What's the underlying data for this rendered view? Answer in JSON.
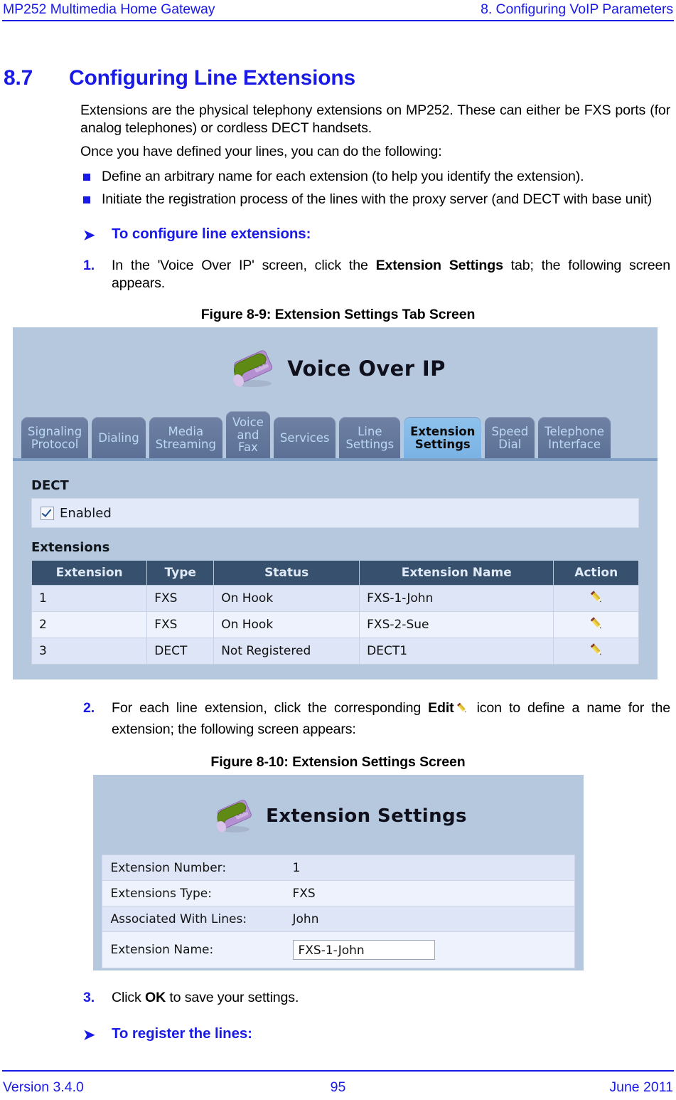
{
  "header": {
    "left": "MP252 Multimedia Home Gateway",
    "right": "8. Configuring VoIP Parameters"
  },
  "section": {
    "number": "8.7",
    "title": "Configuring Line Extensions",
    "intro_p1": "Extensions are the physical telephony extensions on MP252. These can either be FXS ports (for analog telephones) or cordless DECT handsets.",
    "intro_p2": "Once you have defined your lines, you can do the following:",
    "bullets": [
      "Define an arbitrary name for each extension (to help you identify the extension).",
      "Initiate the registration process of the lines with the proxy server (and DECT with base unit)"
    ],
    "procedure_heading_1": "To configure line extensions:",
    "step1_num": "1.",
    "step1_pre": "In the 'Voice Over IP' screen, click the ",
    "step1_bold": "Extension Settings",
    "step1_post": " tab; the following screen appears.",
    "step2_num": "2.",
    "step2_pre": "For each line extension, click the corresponding ",
    "step2_bold": "Edit",
    "step2_post": " icon to define a name for the extension; the following screen appears:",
    "step3_num": "3.",
    "step3_pre": "Click ",
    "step3_bold": "OK",
    "step3_post": " to save your settings.",
    "procedure_heading_2": "To register the lines:",
    "arrow_glyph": "➤"
  },
  "figure1": {
    "caption": "Figure 8-9: Extension Settings Tab Screen",
    "app_title": "Voice Over IP",
    "tabs": [
      {
        "label": "Signaling\nProtocol",
        "active": false
      },
      {
        "label": "Dialing",
        "active": false
      },
      {
        "label": "Media\nStreaming",
        "active": false
      },
      {
        "label": "Voice\nand\nFax",
        "active": false
      },
      {
        "label": "Services",
        "active": false
      },
      {
        "label": "Line\nSettings",
        "active": false
      },
      {
        "label": "Extension\nSettings",
        "active": true
      },
      {
        "label": "Speed\nDial",
        "active": false
      },
      {
        "label": "Telephone\nInterface",
        "active": false
      }
    ],
    "dect_label": "DECT",
    "dect_enabled_label": "Enabled",
    "dect_enabled_checked": true,
    "extensions_label": "Extensions",
    "table": {
      "columns": [
        "Extension",
        "Type",
        "Status",
        "Extension Name",
        "Action"
      ],
      "rows": [
        {
          "extension": "1",
          "type": "FXS",
          "status": "On Hook",
          "name": "FXS-1-John",
          "action": "edit-pencil-icon"
        },
        {
          "extension": "2",
          "type": "FXS",
          "status": "On Hook",
          "name": "FXS-2-Sue",
          "action": "edit-pencil-icon"
        },
        {
          "extension": "3",
          "type": "DECT",
          "status": "Not Registered",
          "name": "DECT1",
          "action": "edit-pencil-icon"
        }
      ]
    }
  },
  "figure2": {
    "caption": "Figure 8-10: Extension Settings Screen",
    "app_title": "Extension Settings",
    "fields": [
      {
        "label": "Extension Number:",
        "value": "1"
      },
      {
        "label": "Extensions Type:",
        "value": "FXS"
      },
      {
        "label": "Associated With Lines:",
        "value": "John"
      }
    ],
    "name_field_label": "Extension Name:",
    "name_field_value": "FXS-1-John"
  },
  "footer": {
    "version": "Version 3.4.0",
    "page": "95",
    "date": "June 2011"
  },
  "colors": {
    "doc_blue": "#1a1ae6",
    "shot_bg": "#b6c8de",
    "tab_inactive": "#6271918",
    "tab_active": "#7db6e8",
    "table_header": "#36506e"
  }
}
